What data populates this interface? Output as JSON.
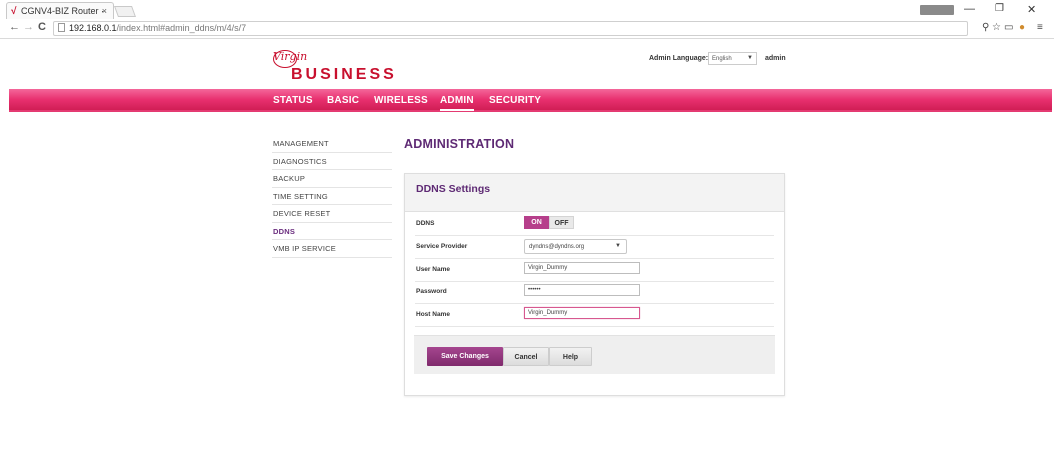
{
  "browser": {
    "tab_title": "CGNV4-BIZ Router ·",
    "tab_close": "×",
    "url_host": "192.168.0.1",
    "url_path": "/index.html#admin_ddns/m/4/s/7"
  },
  "header": {
    "logo_script": "Virgin",
    "logo_text": "BUSINESS",
    "language_label": "Admin Language:",
    "language_value": "English",
    "user": "admin"
  },
  "nav": {
    "items": [
      "STATUS",
      "BASIC",
      "WIRELESS",
      "ADMIN",
      "SECURITY"
    ],
    "active": "ADMIN"
  },
  "sidebar": {
    "items": [
      {
        "label": "MANAGEMENT"
      },
      {
        "label": "DIAGNOSTICS"
      },
      {
        "label": "BACKUP"
      },
      {
        "label": "TIME SETTING"
      },
      {
        "label": "DEVICE RESET"
      },
      {
        "label": "DDNS"
      },
      {
        "label": "VMB IP SERVICE"
      }
    ],
    "active": "DDNS"
  },
  "main": {
    "page_title": "ADMINISTRATION",
    "panel_title": "DDNS Settings",
    "rows": {
      "ddns": {
        "label": "DDNS",
        "on_label": "ON",
        "off_label": "OFF",
        "state": "ON"
      },
      "service_provider": {
        "label": "Service Provider",
        "value": "dyndns@dyndns.org"
      },
      "user_name": {
        "label": "User Name",
        "value": "Virgin_Dummy"
      },
      "password": {
        "label": "Password",
        "value": "••••••"
      },
      "host_name": {
        "label": "Host Name",
        "value": "Virgin_Dummy"
      }
    },
    "buttons": {
      "save": "Save Changes",
      "cancel": "Cancel",
      "help": "Help"
    }
  },
  "colors": {
    "brand_red": "#c8102e",
    "nav_pink": "#e8306f",
    "accent_purple": "#5e2a74",
    "button_purple": "#8f3580"
  }
}
